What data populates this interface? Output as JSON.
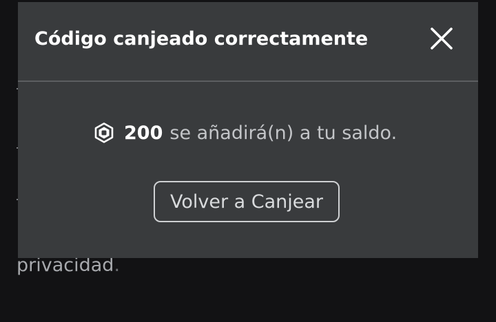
{
  "background": {
    "text": "privacidad",
    "trailing_dot": "."
  },
  "modal": {
    "title": "Código canjeado correctamente",
    "close_icon": "close-x-icon",
    "message": {
      "currency_icon": "robux-icon",
      "amount": "200",
      "text": "se añadirá(n) a tu saldo."
    },
    "button_label": "Volver a Canjear"
  },
  "colors": {
    "page_background": "#121214",
    "modal_background": "#393b3d",
    "divider": "#5c5e61",
    "title_text": "#ffffff",
    "body_text": "#c3c5c8",
    "button_border": "#cfd1d3"
  }
}
